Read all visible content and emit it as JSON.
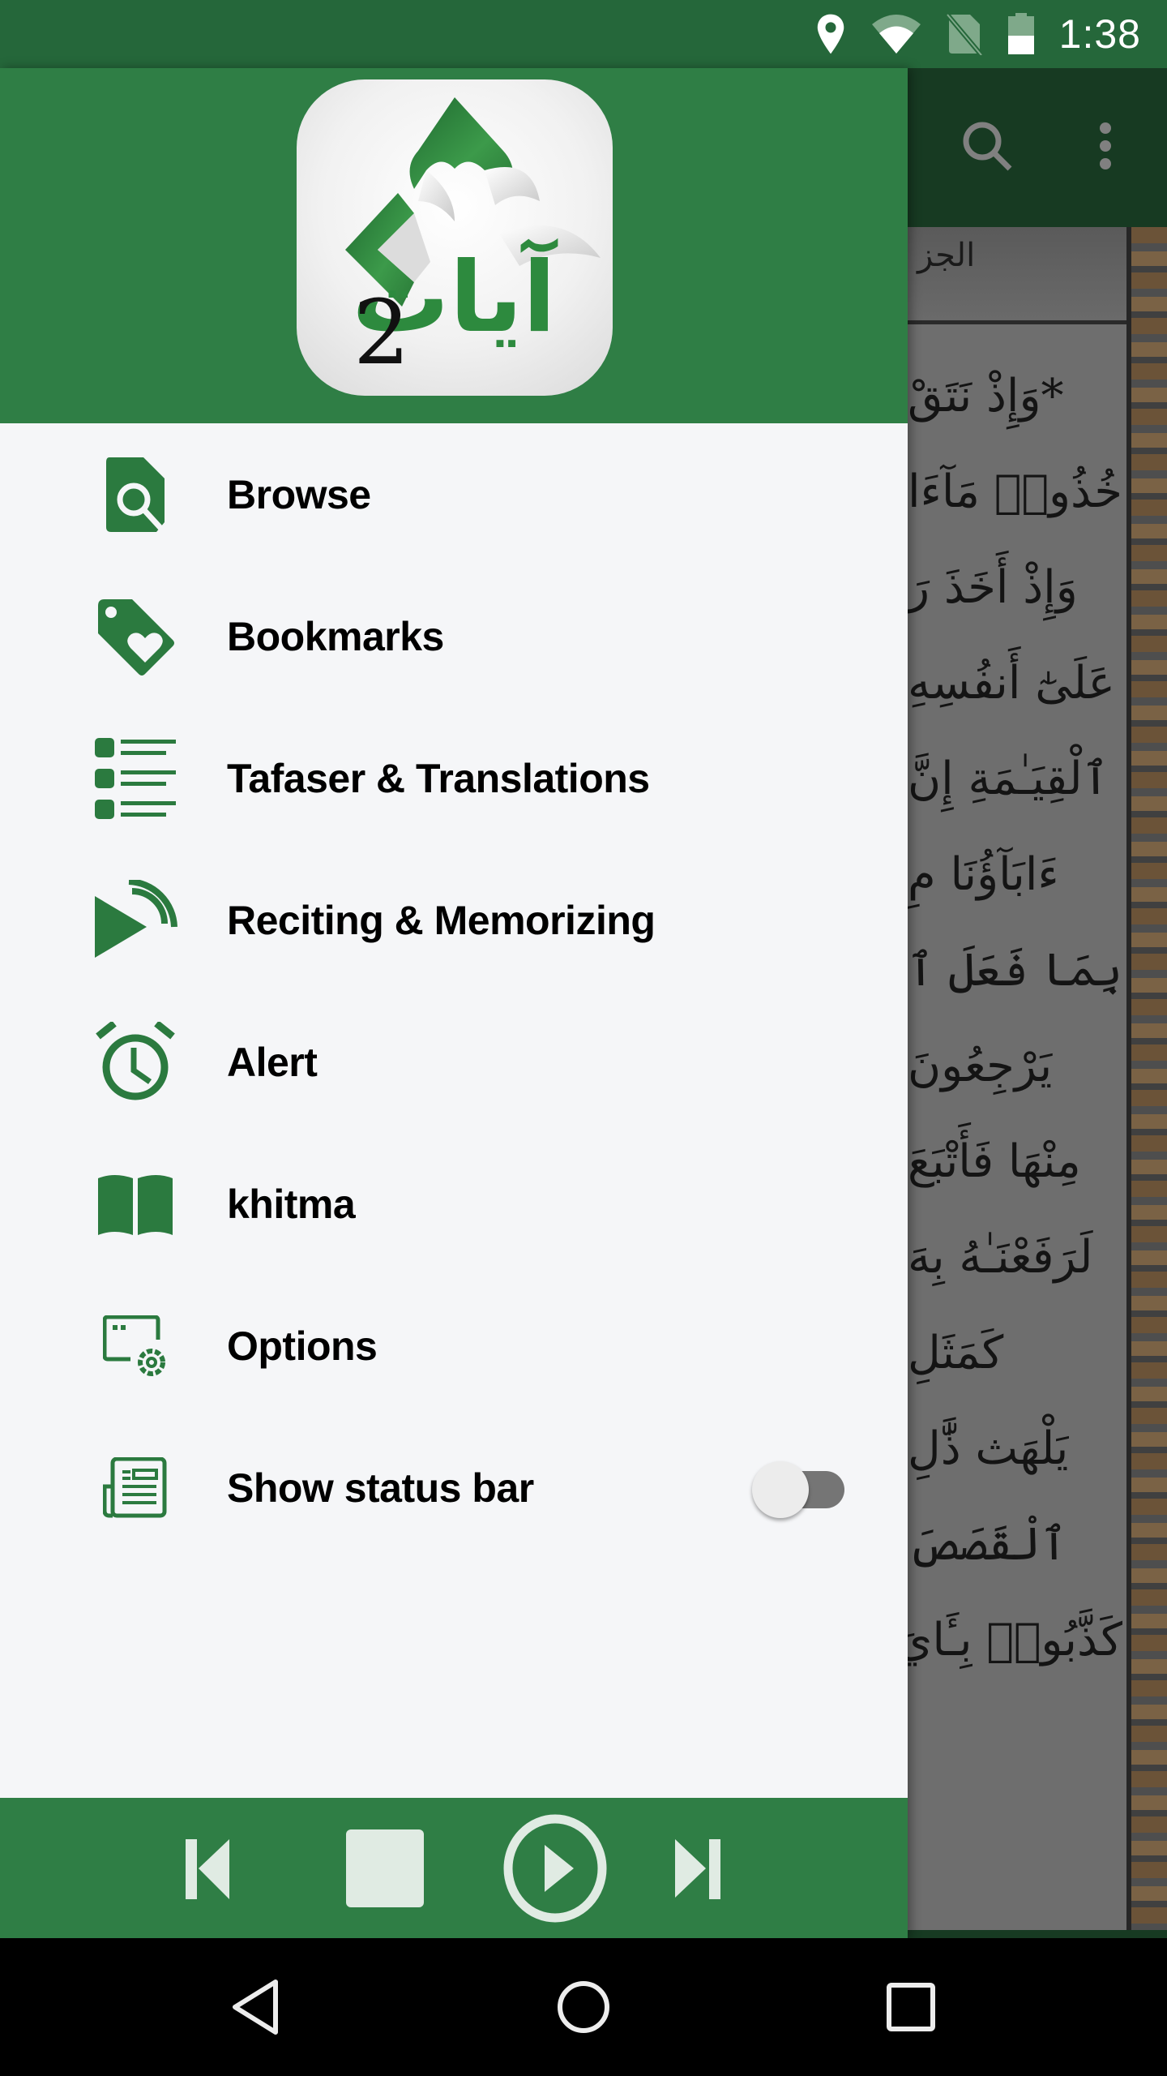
{
  "status_bar": {
    "time": "1:38",
    "icons": [
      "location-icon",
      "wifi-icon",
      "no-sim-icon",
      "battery-icon"
    ],
    "battery_level_percent": 50
  },
  "app": {
    "name": "Ayat 2",
    "logo_text": "آيات",
    "logo_number": "2",
    "colors": {
      "primary": "#2f7e45",
      "status_bar": "#25673a",
      "drawer_bg": "#f5f6f8",
      "icon_green": "#2b7a3f"
    }
  },
  "background_app": {
    "toolbar_icons": [
      "search-icon",
      "more-vert-icon"
    ],
    "juz_label": "الجز",
    "verse_lines": [
      "*وَإِذْ نَتَقْ",
      "خُذُوا۟ مَآءَا",
      "وَإِذْ أَخَذَ رَ",
      "عَلَىٰٓ أَنفُسِهِ",
      "ٱلْقِيَـٰمَةِ إِنَّ",
      "ءَابَآؤُنَا مِ",
      "بِمَا فَعَلَ ٱلْ",
      "يَرْجِعُونَ",
      "مِنْهَا فَأَتْبَعَ",
      "لَرَفَعْنَـٰهُ بِهَ",
      "كَمَثَلِ",
      "يَلْهَث ذَّٰلِ",
      "ٱلْقَصَصَ",
      "كَذَّبُوا۟ بِـَٔايَ"
    ]
  },
  "drawer": {
    "menu": [
      {
        "id": "browse",
        "label": "Browse",
        "icon": "file-search-icon"
      },
      {
        "id": "bookmarks",
        "label": "Bookmarks",
        "icon": "tag-heart-icon"
      },
      {
        "id": "tafaser",
        "label": "Tafaser & Translations",
        "icon": "list-icon"
      },
      {
        "id": "reciting",
        "label": "Reciting & Memorizing",
        "icon": "play-broadcast-icon"
      },
      {
        "id": "alert",
        "label": "Alert",
        "icon": "alarm-clock-icon"
      },
      {
        "id": "khitma",
        "label": "khitma",
        "icon": "open-book-icon"
      },
      {
        "id": "options",
        "label": "Options",
        "icon": "window-settings-icon"
      },
      {
        "id": "status_bar",
        "label": "Show status bar",
        "icon": "newspaper-icon",
        "toggle": false
      }
    ]
  },
  "player": {
    "controls": [
      "skip-previous",
      "stop",
      "play",
      "skip-next"
    ]
  },
  "nav_bar": {
    "buttons": [
      "back",
      "home",
      "recents"
    ]
  }
}
